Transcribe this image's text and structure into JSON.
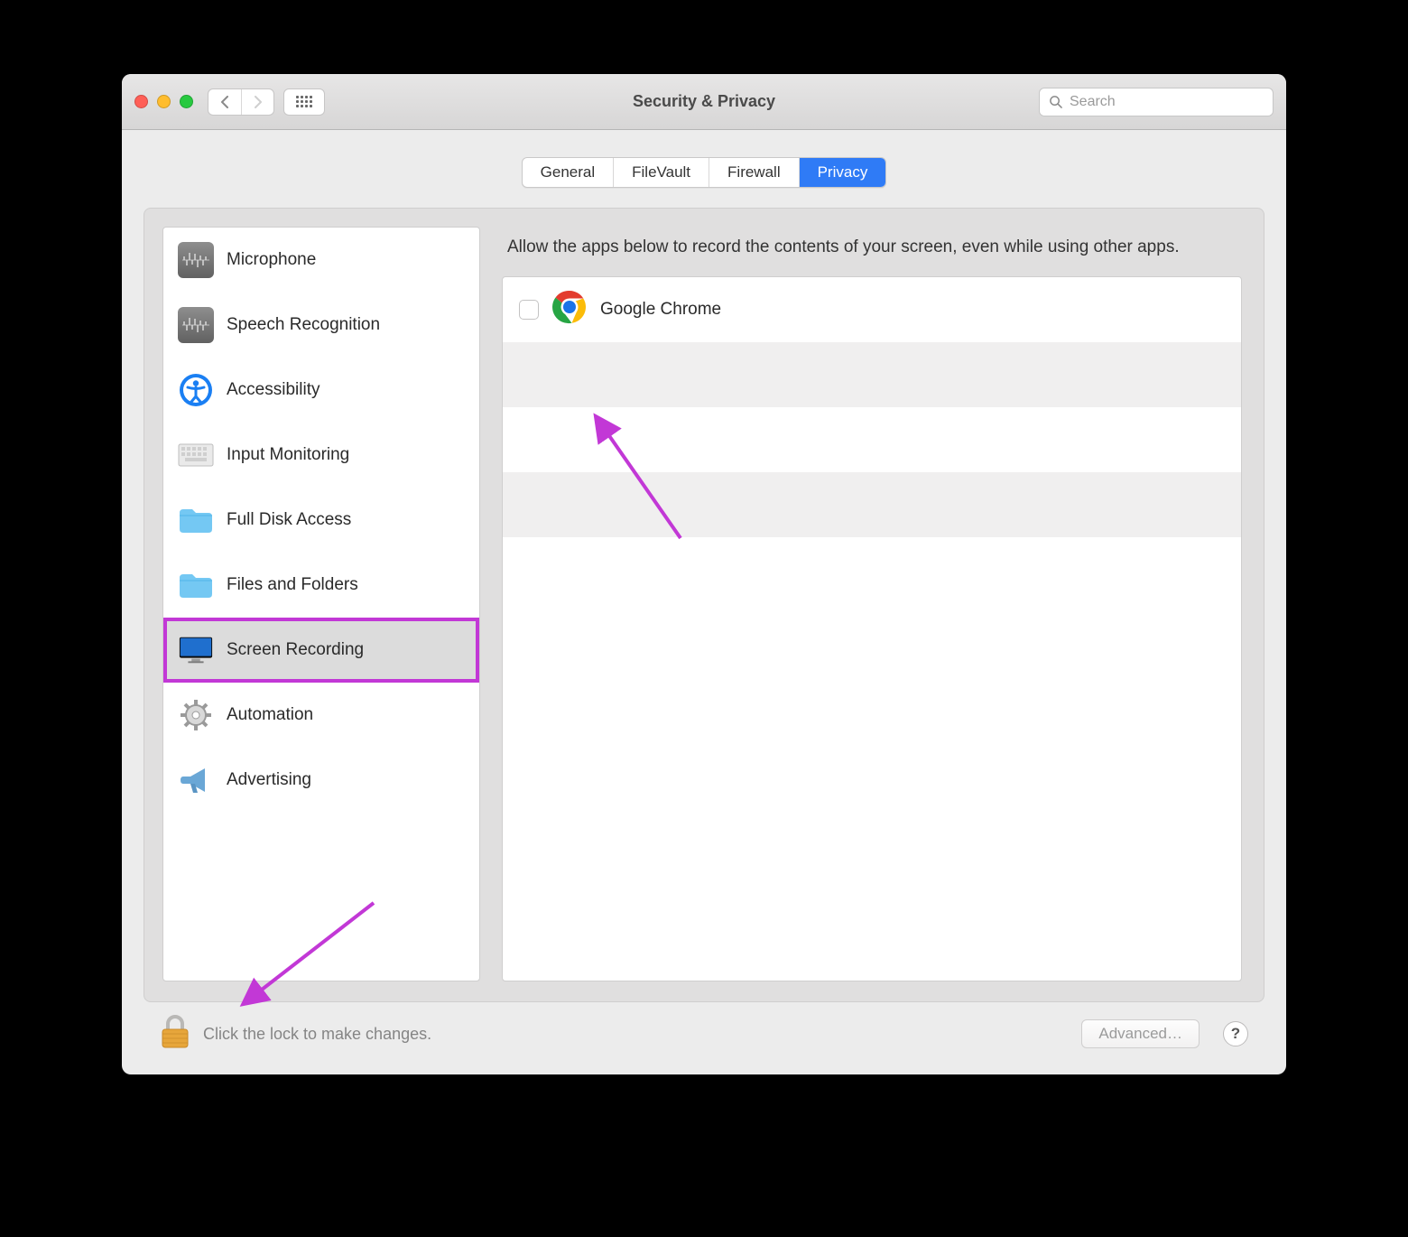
{
  "window": {
    "title": "Security & Privacy"
  },
  "search": {
    "placeholder": "Search"
  },
  "tabs": [
    {
      "label": "General",
      "active": false
    },
    {
      "label": "FileVault",
      "active": false
    },
    {
      "label": "Firewall",
      "active": false
    },
    {
      "label": "Privacy",
      "active": true
    }
  ],
  "sidebar": {
    "items": [
      {
        "label": "Microphone",
        "icon": "microphone-icon"
      },
      {
        "label": "Speech Recognition",
        "icon": "speech-icon"
      },
      {
        "label": "Accessibility",
        "icon": "accessibility-icon"
      },
      {
        "label": "Input Monitoring",
        "icon": "keyboard-icon"
      },
      {
        "label": "Full Disk Access",
        "icon": "folder-icon"
      },
      {
        "label": "Files and Folders",
        "icon": "folder-icon"
      },
      {
        "label": "Screen Recording",
        "icon": "display-icon",
        "selected": true
      },
      {
        "label": "Automation",
        "icon": "gear-icon"
      },
      {
        "label": "Advertising",
        "icon": "megaphone-icon"
      }
    ]
  },
  "content": {
    "description": "Allow the apps below to record the contents of your screen, even while using other apps.",
    "apps": [
      {
        "name": "Google Chrome",
        "checked": false,
        "icon": "chrome-icon"
      }
    ]
  },
  "footer": {
    "lock_text": "Click the lock to make changes.",
    "advanced_label": "Advanced…",
    "help_label": "?"
  },
  "annotations": {
    "arrow_color": "#c238d6"
  }
}
